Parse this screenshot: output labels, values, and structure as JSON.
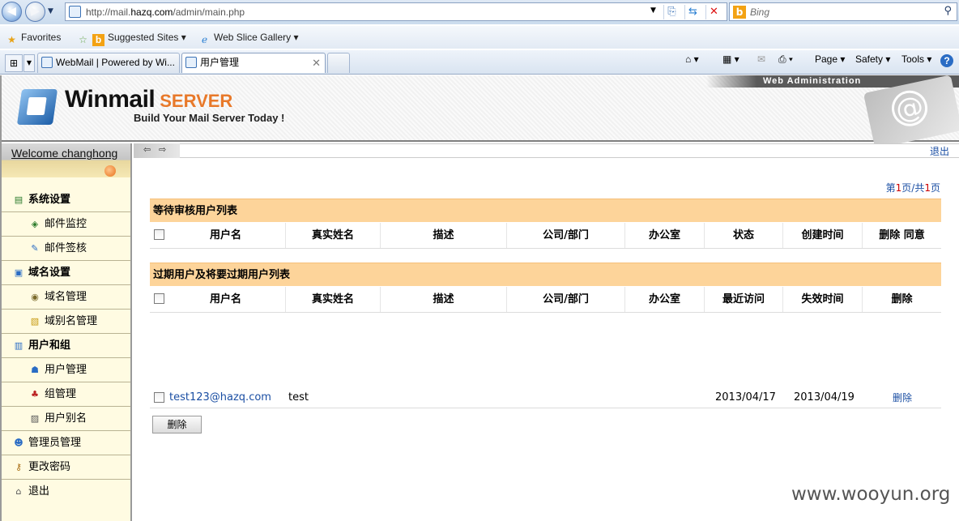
{
  "browser": {
    "url_prefix": "http://mail.",
    "url_host": "hazq.com",
    "url_path": "/admin/main.php",
    "search_placeholder": "Bing",
    "favorites": [
      {
        "label": "Favorites",
        "icon": "star-icon"
      },
      {
        "label": "Suggested Sites",
        "icon": "bing-icon"
      },
      {
        "label": "Web Slice Gallery",
        "icon": "ie-icon"
      }
    ],
    "tabs": [
      {
        "label": "WebMail | Powered by Wi..."
      },
      {
        "label": "用户管理"
      }
    ],
    "tools": [
      "Page",
      "Safety",
      "Tools"
    ]
  },
  "banner": {
    "logo_main": "Winmail",
    "logo_server": "SERVER",
    "slogan": "Build Your Mail Server Today !",
    "web_admin": "Web Administration"
  },
  "sidebar": {
    "welcome": "Welcome changhong",
    "items": [
      {
        "label": "系统设置",
        "type": "cat",
        "icon": "settings-icon"
      },
      {
        "label": "邮件监控",
        "type": "sub",
        "icon": "monitor-icon"
      },
      {
        "label": "邮件签核",
        "type": "sub",
        "icon": "approve-icon"
      },
      {
        "label": "域名设置",
        "type": "cat",
        "icon": "domain-icon"
      },
      {
        "label": "域名管理",
        "type": "sub",
        "icon": "domain-manage-icon"
      },
      {
        "label": "域别名管理",
        "type": "sub",
        "icon": "alias-icon"
      },
      {
        "label": "用户和组",
        "type": "cat",
        "icon": "users-groups-icon"
      },
      {
        "label": "用户管理",
        "type": "sub",
        "icon": "user-manage-icon"
      },
      {
        "label": "组管理",
        "type": "sub",
        "icon": "group-icon"
      },
      {
        "label": "用户别名",
        "type": "sub",
        "icon": "user-alias-icon"
      },
      {
        "label": "管理员管理",
        "type": "plain",
        "icon": "admin-icon"
      },
      {
        "label": "更改密码",
        "type": "plain",
        "icon": "key-icon"
      },
      {
        "label": "退出",
        "type": "plain",
        "icon": "home-icon"
      }
    ]
  },
  "content": {
    "logout": "退出",
    "page_info": {
      "prefix": "第",
      "current": "1",
      "mid": "页/共",
      "total": "1",
      "suffix": "页"
    },
    "pending": {
      "title": "等待审核用户列表",
      "headers": [
        "用户名",
        "真实姓名",
        "描述",
        "公司/部门",
        "办公室",
        "状态",
        "创建时间",
        "删除 同意"
      ]
    },
    "expired": {
      "title": "过期用户及将要过期用户列表",
      "headers": [
        "用户名",
        "真实姓名",
        "描述",
        "公司/部门",
        "办公室",
        "最近访问",
        "失效时间",
        "删除"
      ],
      "rows": [
        {
          "username": "test123@hazq.com",
          "realname": "test",
          "desc": "",
          "dept": "",
          "office": "",
          "last_access": "2013/04/17",
          "expire": "2013/04/19",
          "action": "删除"
        }
      ]
    },
    "delete_button": "删除"
  },
  "watermark": "www.wooyun.org"
}
